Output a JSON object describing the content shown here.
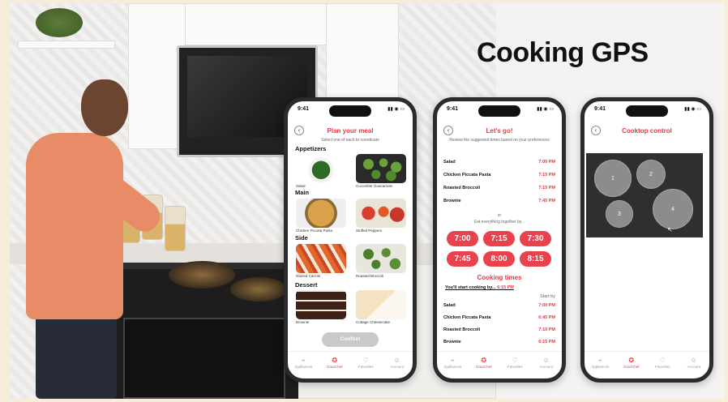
{
  "headline": "Cooking GPS",
  "status_time": "9:41",
  "status_icons": "▮▮ ◉ ▭",
  "tabs": [
    {
      "label": "Appliances",
      "icon": "⌁"
    },
    {
      "label": "GourChef",
      "icon": "✪"
    },
    {
      "label": "Favorites",
      "icon": "♡"
    },
    {
      "label": "Account",
      "icon": "☺"
    }
  ],
  "phone1": {
    "title": "Plan your meal",
    "subtitle": "Select one of each to coordinate",
    "sections": {
      "appetizers": "Appetizers",
      "main": "Main",
      "side": "Side",
      "dessert": "Dessert"
    },
    "items": {
      "salad": "Salad",
      "guacamole": "Cucumber Guacamole",
      "pasta": "Chicken Piccata Pasta",
      "peppers": "Stuffed Peppers",
      "carrots": "Glazed Carrots",
      "broccoli": "Roasted Broccoli",
      "brownie": "Brownie",
      "cheesecake": "Cottage Cheesecake"
    },
    "confirm": "Confirm"
  },
  "phone2": {
    "title": "Let's go!",
    "subtitle": "Review the suggested times based on your preferences",
    "rows": [
      {
        "name": "Salad",
        "time": "7:00 PM"
      },
      {
        "name": "Chicken Piccata Pasta",
        "time": "7:15 PM"
      },
      {
        "name": "Roasted Broccoli",
        "time": "7:15 PM"
      },
      {
        "name": "Brownie",
        "time": "7:45 PM"
      }
    ],
    "or": "or",
    "eat_together": "Eat everything together by...",
    "times": [
      "7:00",
      "7:15",
      "7:30",
      "7:45",
      "8:00",
      "8:15"
    ],
    "cooking_times_title": "Cooking times",
    "start_line": "You'll start cooking by...",
    "start_time": "6:15 PM",
    "start_by": "Start by",
    "cook_rows": [
      {
        "name": "Salad",
        "time": "7:00 PM"
      },
      {
        "name": "Chicken Piccata Pasta",
        "time": "6:45 PM"
      },
      {
        "name": "Roasted Broccoli",
        "time": "7:10 PM"
      },
      {
        "name": "Brownie",
        "time": "6:15 PM"
      }
    ]
  },
  "phone3": {
    "title": "Cooktop control",
    "burners": [
      "1",
      "2",
      "3",
      "4"
    ]
  },
  "colors": {
    "accent": "#e23b45",
    "pill": "#e8424c",
    "cooktop": "#2f2f2f"
  }
}
